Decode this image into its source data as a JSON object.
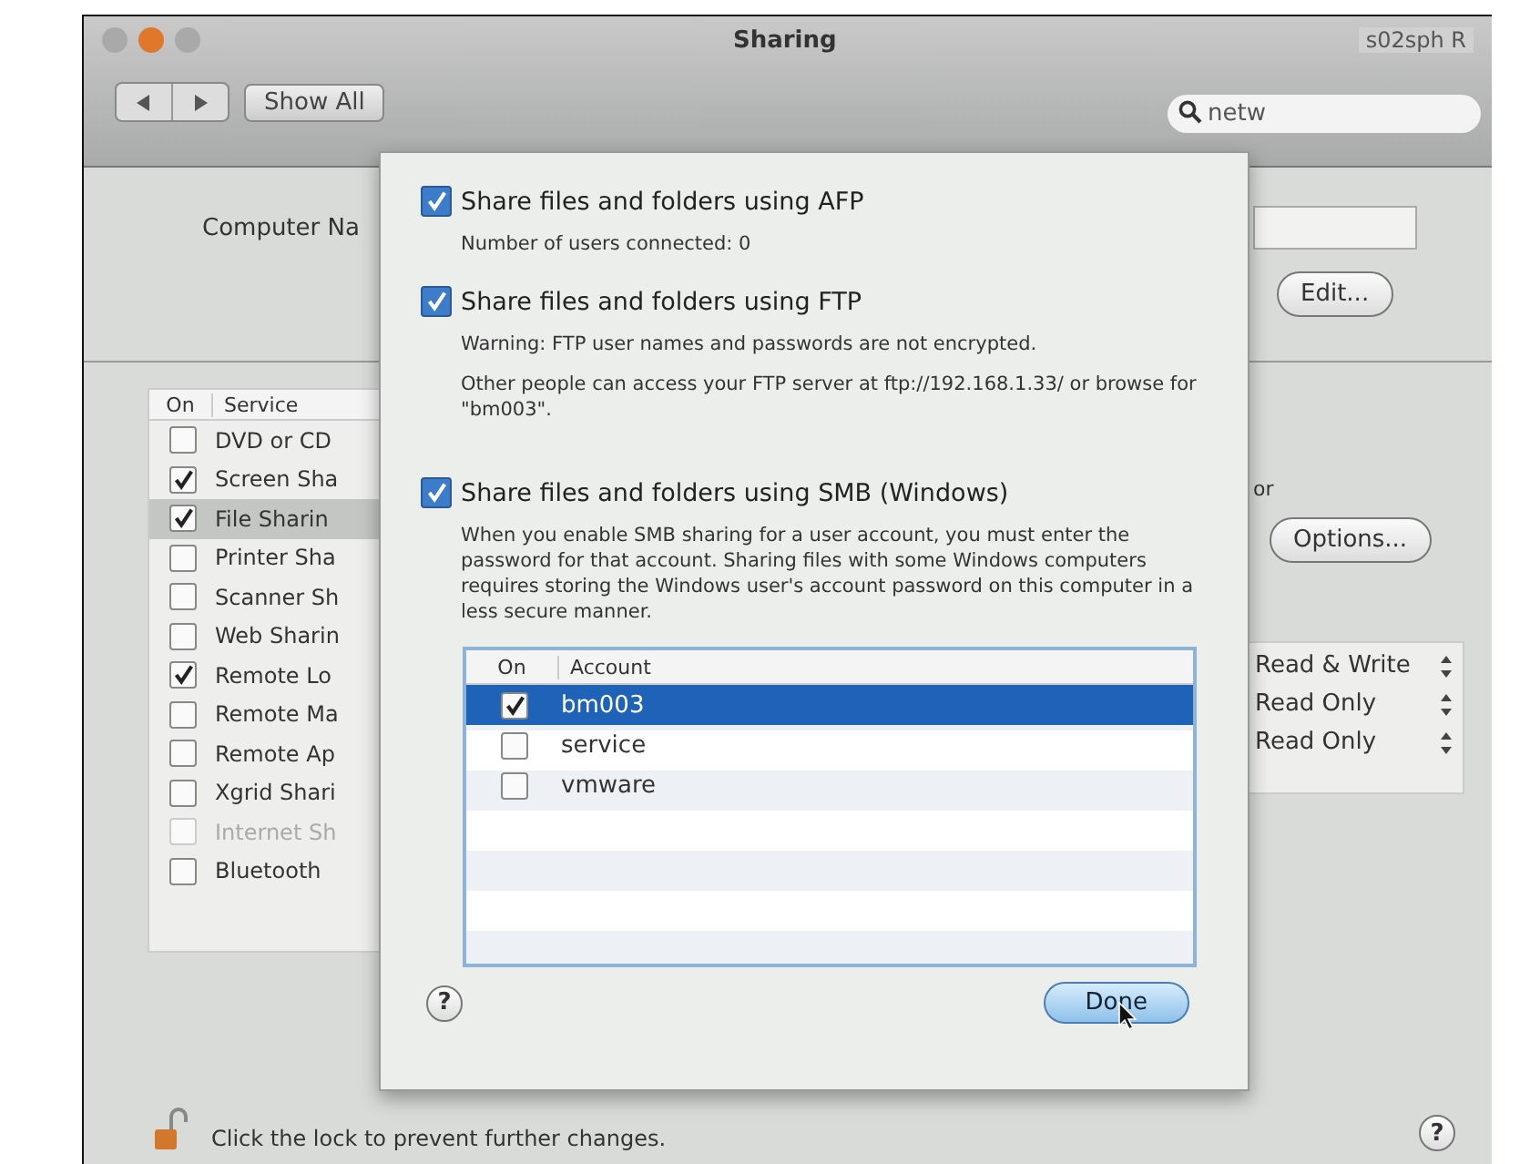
{
  "window": {
    "title": "Sharing",
    "traffic_lights": [
      {
        "color": "#a9a9a9"
      },
      {
        "color": "#e0782c"
      },
      {
        "color": "#a9a9a9"
      }
    ]
  },
  "menubar_fragment": "s02sph R",
  "toolbar": {
    "show_all": "Show All",
    "search": {
      "value": "netw"
    }
  },
  "computer_name": {
    "label": "Computer Na",
    "edit_button": "Edit..."
  },
  "services": {
    "columns": [
      "On",
      "Service"
    ],
    "rows": [
      {
        "name": "DVD or CD",
        "checked": false,
        "selected": false,
        "disabled": false
      },
      {
        "name": "Screen Sha",
        "checked": true,
        "selected": false,
        "disabled": false
      },
      {
        "name": "File Sharin",
        "checked": true,
        "selected": true,
        "disabled": false
      },
      {
        "name": "Printer Sha",
        "checked": false,
        "selected": false,
        "disabled": false
      },
      {
        "name": "Scanner Sh",
        "checked": false,
        "selected": false,
        "disabled": false
      },
      {
        "name": "Web Sharin",
        "checked": false,
        "selected": false,
        "disabled": false
      },
      {
        "name": "Remote Lo",
        "checked": true,
        "selected": false,
        "disabled": false
      },
      {
        "name": "Remote Ma",
        "checked": false,
        "selected": false,
        "disabled": false
      },
      {
        "name": "Remote Ap",
        "checked": false,
        "selected": false,
        "disabled": false
      },
      {
        "name": "Xgrid Shari",
        "checked": false,
        "selected": false,
        "disabled": false
      },
      {
        "name": "Internet Sh",
        "checked": false,
        "selected": false,
        "disabled": true
      },
      {
        "name": "Bluetooth",
        "checked": false,
        "selected": false,
        "disabled": false
      }
    ]
  },
  "text_fragment": "or",
  "options_button": "Options...",
  "permissions": [
    "Read & Write",
    "Read Only",
    "Read Only"
  ],
  "lock_text": "Click the lock to prevent further changes.",
  "help_button": "?",
  "sheet": {
    "protocols": [
      {
        "label": "Share files and folders using AFP",
        "checked": true,
        "notes": [
          "Number of users connected: 0"
        ]
      },
      {
        "label": "Share files and folders using FTP",
        "checked": true,
        "notes": [
          "Warning: FTP user names and passwords are not encrypted.",
          "Other people can access your FTP server at ftp://192.168.1.33/ or browse for \"bm003\"."
        ]
      },
      {
        "label": "Share files and folders using SMB (Windows)",
        "checked": true,
        "notes": [
          "When you enable SMB sharing for a user account, you must enter the password for that account. Sharing files with some Windows computers requires storing the Windows user's account password on this computer in a less secure manner."
        ]
      }
    ],
    "accounts": {
      "columns": [
        "On",
        "Account"
      ],
      "rows": [
        {
          "name": "bm003",
          "checked": true,
          "selected": true
        },
        {
          "name": "service",
          "checked": false,
          "selected": false
        },
        {
          "name": "vmware",
          "checked": false,
          "selected": false
        }
      ]
    },
    "help_button": "?",
    "done_button": "Done"
  }
}
